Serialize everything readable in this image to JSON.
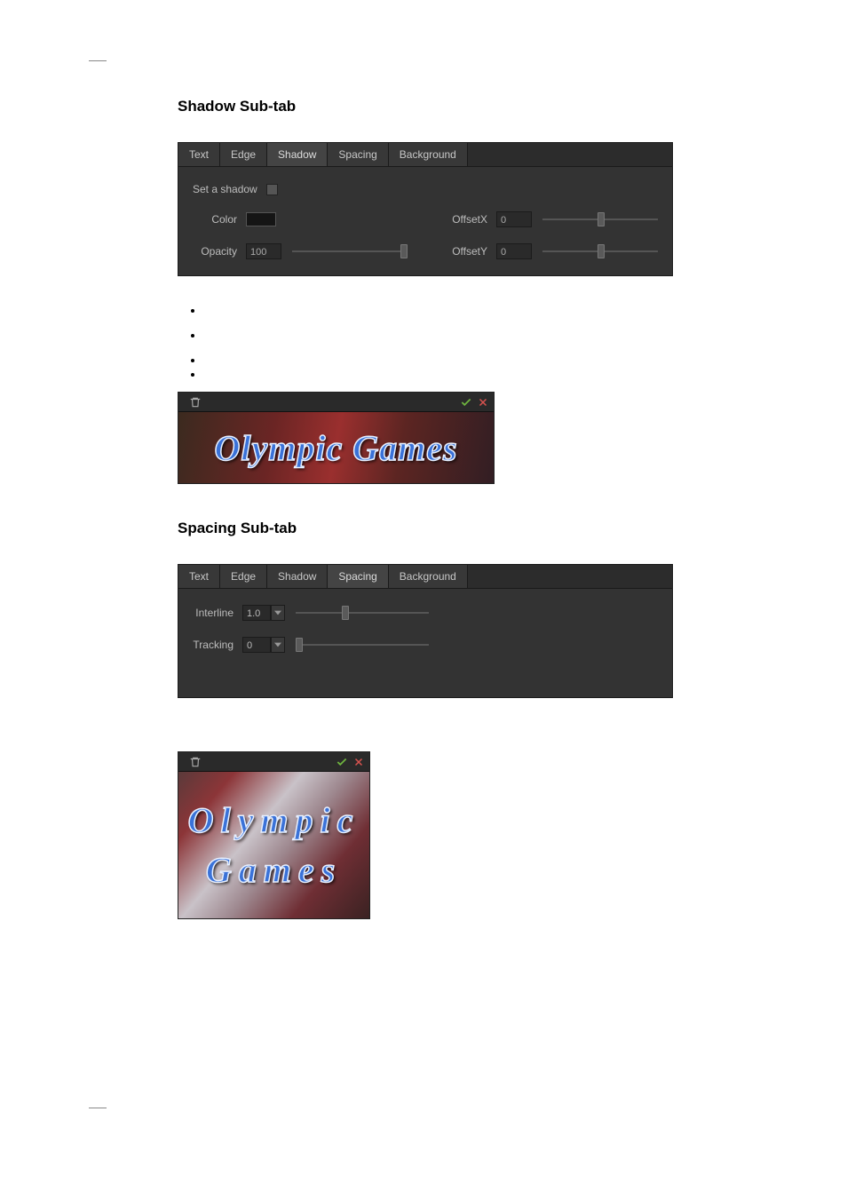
{
  "headings": {
    "shadow": "Shadow  Sub-tab",
    "spacing": "Spacing  Sub-tab"
  },
  "tabs": {
    "text": "Text",
    "edge": "Edge",
    "shadow": "Shadow",
    "spacing": "Spacing",
    "background": "Background"
  },
  "shadow_panel": {
    "set_shadow": "Set a shadow",
    "color": "Color",
    "opacity": "Opacity",
    "opacity_value": "100",
    "offsetx": "OffsetX",
    "offsetx_value": "0",
    "offsety": "OffsetY",
    "offsety_value": "0"
  },
  "spacing_panel": {
    "interline": "Interline",
    "interline_value": "1.0",
    "tracking": "Tracking",
    "tracking_value": "0"
  },
  "preview": {
    "text1": "Olympic Games",
    "text2_line1": "Olympic",
    "text2_line2": "Games"
  }
}
